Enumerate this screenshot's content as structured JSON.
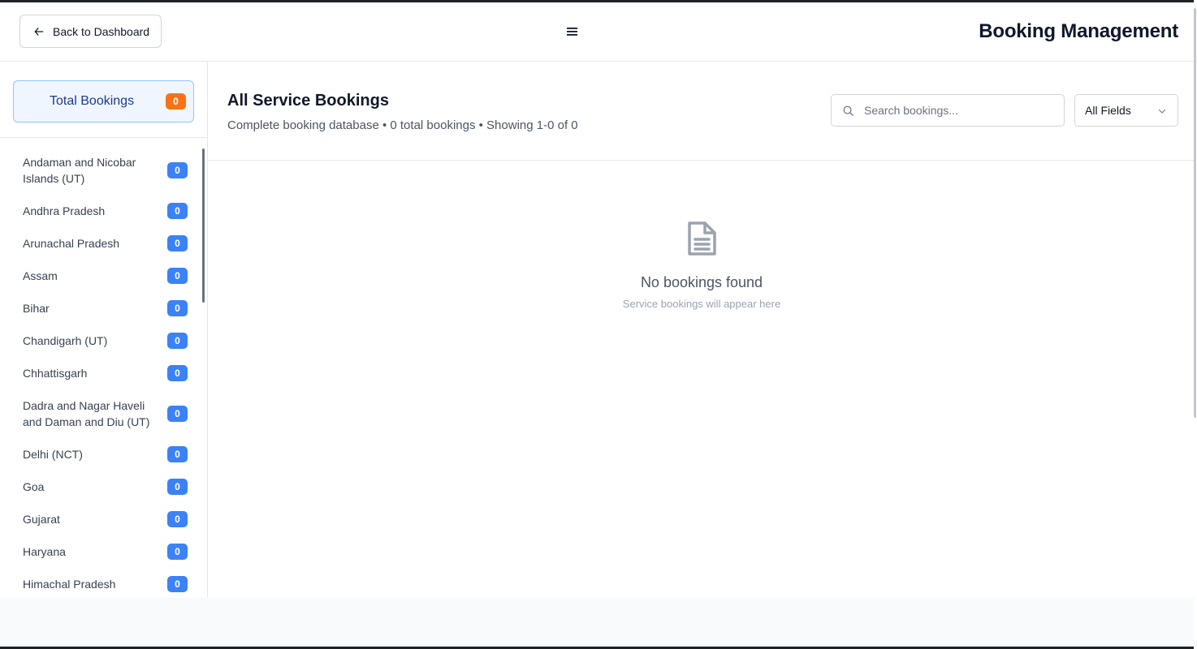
{
  "header": {
    "back_label": "Back to Dashboard",
    "back_icon": "arrow-left-icon",
    "menu_icon": "hamburger-menu-icon",
    "title": "Booking Management"
  },
  "sidebar": {
    "total": {
      "label": "Total Bookings",
      "count": "0",
      "badge_color": "#f97316"
    },
    "states": [
      {
        "label": "Andaman and Nicobar Islands (UT)",
        "count": "0"
      },
      {
        "label": "Andhra Pradesh",
        "count": "0"
      },
      {
        "label": "Arunachal Pradesh",
        "count": "0"
      },
      {
        "label": "Assam",
        "count": "0"
      },
      {
        "label": "Bihar",
        "count": "0"
      },
      {
        "label": "Chandigarh (UT)",
        "count": "0"
      },
      {
        "label": "Chhattisgarh",
        "count": "0"
      },
      {
        "label": "Dadra and Nagar Haveli and Daman and Diu (UT)",
        "count": "0"
      },
      {
        "label": "Delhi (NCT)",
        "count": "0"
      },
      {
        "label": "Goa",
        "count": "0"
      },
      {
        "label": "Gujarat",
        "count": "0"
      },
      {
        "label": "Haryana",
        "count": "0"
      },
      {
        "label": "Himachal Pradesh",
        "count": "0"
      }
    ],
    "badge_color": "#3b82f6"
  },
  "main": {
    "title": "All Service Bookings",
    "subtitle": "Complete booking database • 0 total bookings • Showing 1-0 of 0",
    "search": {
      "placeholder": "Search bookings...",
      "value": "",
      "icon": "search-icon"
    },
    "field_filter": {
      "selected": "All Fields",
      "icon": "chevron-down-icon"
    },
    "empty_state": {
      "icon": "document-icon",
      "title": "No bookings found",
      "subtitle": "Service bookings will appear here"
    }
  }
}
